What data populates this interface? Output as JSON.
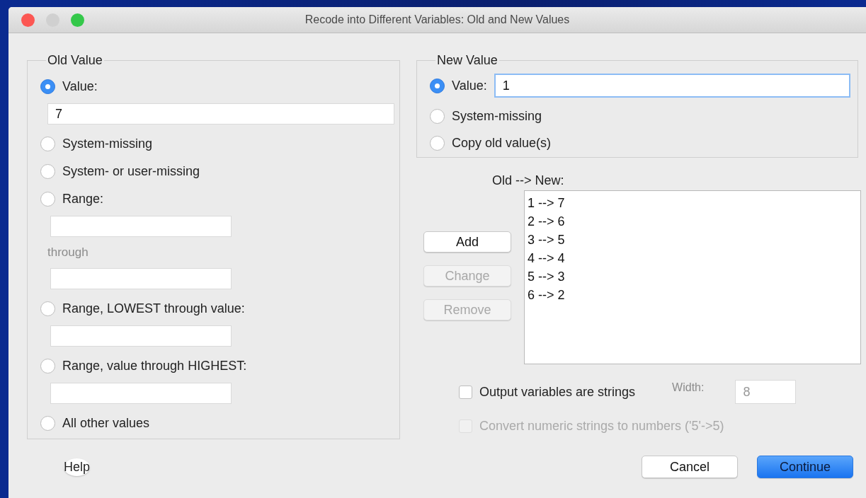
{
  "window": {
    "title": "Recode into Different Variables: Old and New Values"
  },
  "old_value": {
    "legend": "Old Value",
    "options": [
      {
        "kind": "value",
        "label": "Value:",
        "selected": true,
        "value": "7"
      },
      {
        "kind": "plain",
        "label": "System-missing",
        "selected": false
      },
      {
        "kind": "plain",
        "label": "System- or user-missing",
        "selected": false
      },
      {
        "kind": "range",
        "label": "Range:",
        "selected": false,
        "through_label": "through"
      },
      {
        "kind": "single_field",
        "label": "Range, LOWEST through value:",
        "selected": false
      },
      {
        "kind": "single_field",
        "label": "Range, value through HIGHEST:",
        "selected": false
      },
      {
        "kind": "plain",
        "label": "All other values",
        "selected": false
      }
    ]
  },
  "new_value": {
    "legend": "New Value",
    "options": [
      {
        "kind": "inline_value",
        "label": "Value:",
        "selected": true,
        "value": "1"
      },
      {
        "kind": "plain",
        "label": "System-missing",
        "selected": false
      },
      {
        "kind": "plain",
        "label": "Copy old value(s)",
        "selected": false
      }
    ]
  },
  "mapping": {
    "label": "Old --> New:",
    "items": [
      "1 --> 7",
      "2 --> 6",
      "3 --> 5",
      "4 --> 4",
      "5 --> 3",
      "6 --> 2"
    ]
  },
  "actions": [
    {
      "label": "Add",
      "disabled": false
    },
    {
      "label": "Change",
      "disabled": true
    },
    {
      "label": "Remove",
      "disabled": true
    }
  ],
  "checkboxes": [
    {
      "label": "Output variables are strings",
      "checked": false,
      "disabled": false
    },
    {
      "label": "Convert numeric strings to numbers ('5'->5)",
      "checked": false,
      "disabled": true
    }
  ],
  "width": {
    "label": "Width:",
    "value": "8",
    "disabled": true
  },
  "help": "Help",
  "buttons": [
    {
      "label": "Cancel",
      "default": false
    },
    {
      "label": "Continue",
      "default": true
    }
  ]
}
